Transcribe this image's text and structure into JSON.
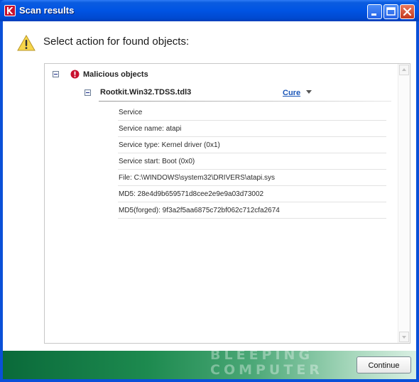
{
  "window": {
    "title": "Scan results",
    "controls": [
      "minimize",
      "maximize",
      "close"
    ]
  },
  "header": {
    "title": "Select action for found objects:",
    "icon": "warning-icon"
  },
  "tree": {
    "group_label": "Malicious objects",
    "group_icon": "error-icon",
    "threat": {
      "name": "Rootkit.Win32.TDSS.tdl3",
      "action": "Cure",
      "details": [
        "Service",
        "Service name: atapi",
        "Service type: Kernel driver (0x1)",
        "Service start: Boot (0x0)",
        "File: C:\\WINDOWS\\system32\\DRIVERS\\atapi.sys",
        "MD5: 28e4d9b659571d8cee2e9e9a03d73002",
        "MD5(forged): 9f3a2f5aa6875c72bf062c712cfa2674"
      ]
    }
  },
  "footer": {
    "watermark_line1": "BLEEPING",
    "watermark_line2": "COMPUTER",
    "continue_label": "Continue"
  },
  "colors": {
    "titlebar": "#0054e3",
    "link": "#1a56b8",
    "footer_green": "#1d8a4f"
  }
}
